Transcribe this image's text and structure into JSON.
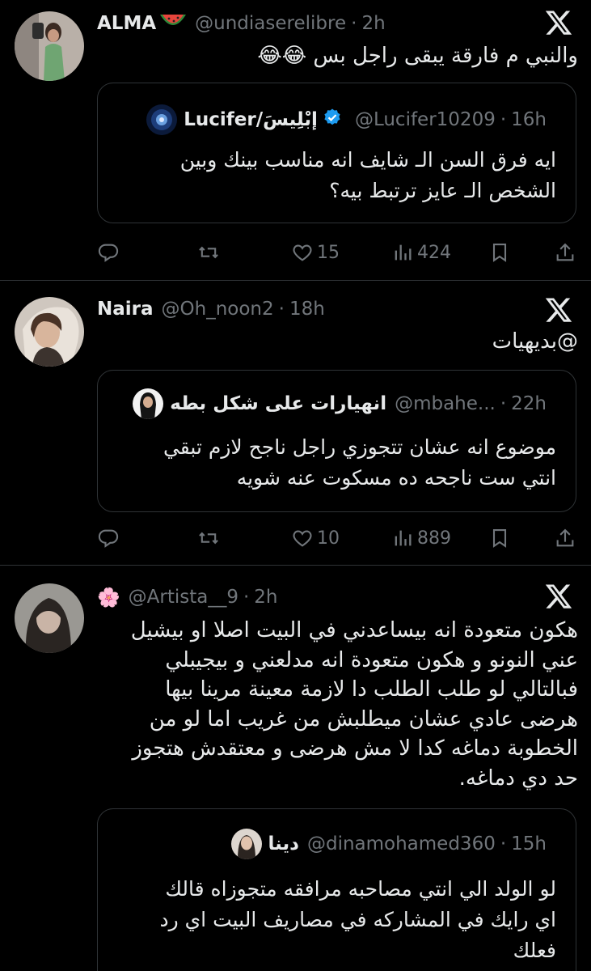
{
  "tweets": [
    {
      "name": "ALMA",
      "handle": "@undiaserelibre",
      "sep": "·",
      "time": "2h",
      "body_lines": [
        "والنبي م فارقة يبقى راجل بس 😂😂"
      ],
      "quote": {
        "name": "Lucifer/إبْلِيسَ",
        "handle": "@Lucifer10209",
        "time": "16h",
        "lines": [
          "ايه فرق السن الـ شايف انه مناسب بينك وبين",
          "الشخص الـ عايز ترتبط بيه؟"
        ]
      },
      "likes": "15",
      "views": "424"
    },
    {
      "name": "Naira",
      "handle": "@Oh_noon2",
      "sep": "·",
      "time": "18h",
      "body_lines": [
        "@بديهيات"
      ],
      "quote": {
        "name": "انهيارات على شكل بطه",
        "handle": "@mbahe...",
        "time": "22h",
        "lines": [
          "موضوع انه عشان تتجوزي راجل ناجح لازم تبقي",
          "انتي ست ناجحه ده مسكوت عنه شويه"
        ]
      },
      "likes": "10",
      "views": "889"
    },
    {
      "name": "🌸",
      "handle": "@Artista__9",
      "sep": "·",
      "time": "2h",
      "body_lines": [
        "هكون متعودة انه بيساعدني في البيت اصلا او بيشيل",
        "عني النونو و هكون متعودة انه مدلعني و بيجيبلي",
        "فبالتالي لو طلب الطلب دا لازمة معينة مرينا بيها",
        "هرضى عادي عشان ميطلبش من غريب اما لو من",
        "الخطوبة دماغه كدا لا مش هرضى و معتقدش هتجوز",
        "حد دي دماغه."
      ],
      "quote": {
        "name": "دينا",
        "handle": "@dinamohamed360",
        "time": "15h",
        "lines": [
          "لو الولد الي انتي مصاحبه مرافقه متجوزاه قالك",
          "اي رايك في المشاركه في مصاريف البيت اي رد",
          "فعلك"
        ]
      }
    }
  ],
  "icons": {
    "header_emoji": "watermelon",
    "close": "x-logo",
    "actions": [
      "reply-icon",
      "retweet-icon",
      "like-icon",
      "views-icon",
      "bookmark-icon",
      "share-icon"
    ]
  },
  "colors": {
    "background": "#000000",
    "text": "#e7e9ea",
    "muted": "#71767b",
    "border": "#2f3336",
    "verified": "#1d9bf0"
  }
}
